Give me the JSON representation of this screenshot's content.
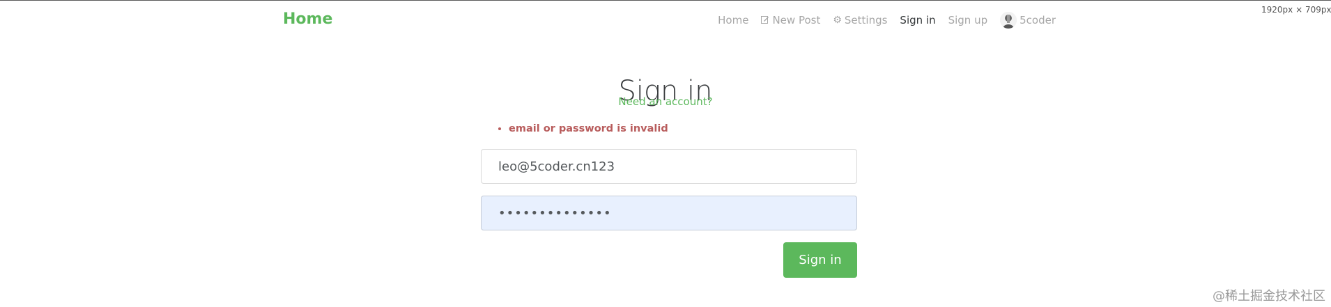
{
  "resolution_text": "1920px × 709px",
  "navbar": {
    "brand": "Home",
    "links": [
      {
        "label": "Home",
        "icon": null,
        "active": false
      },
      {
        "label": "New Post",
        "icon": "edit-icon",
        "active": false
      },
      {
        "label": "Settings",
        "icon": "gear-icon",
        "active": false
      },
      {
        "label": "Sign in",
        "icon": null,
        "active": true
      },
      {
        "label": "Sign up",
        "icon": null,
        "active": false
      }
    ],
    "user": {
      "name": "5coder",
      "avatar_icon": "avatar"
    }
  },
  "auth": {
    "title": "Sign in",
    "need_account": "Need an account?",
    "errors": [
      "email or password is invalid"
    ],
    "email_value": "leo@5coder.cn123",
    "password_masked": "••••••••••••••",
    "submit_label": "Sign in"
  },
  "watermark": "@稀土掘金技术社区",
  "colors": {
    "brand": "#5cb85c",
    "error": "#b85c5c",
    "nav_inactive": "#a7a7a7",
    "nav_active": "#373a3c",
    "autofill_bg": "#e8f0fe"
  }
}
